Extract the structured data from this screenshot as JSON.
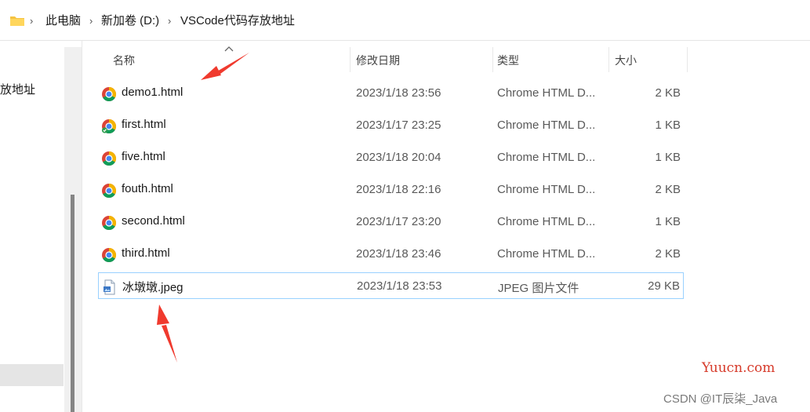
{
  "breadcrumb": {
    "items": [
      "此电脑",
      "新加卷 (D:)",
      "VSCode代码存放地址"
    ],
    "separator": "›"
  },
  "nav": {
    "partial_item": "放地址"
  },
  "columns": {
    "name": "名称",
    "date": "修改日期",
    "type": "类型",
    "size": "大小"
  },
  "files": [
    {
      "name": "demo1.html",
      "date": "2023/1/18 23:56",
      "type": "Chrome HTML D...",
      "size": "2 KB",
      "icon": "chrome-icon"
    },
    {
      "name": "first.html",
      "date": "2023/1/17 23:25",
      "type": "Chrome HTML D...",
      "size": "1 KB",
      "icon": "chrome-icon"
    },
    {
      "name": "five.html",
      "date": "2023/1/18 20:04",
      "type": "Chrome HTML D...",
      "size": "1 KB",
      "icon": "chrome-icon"
    },
    {
      "name": "fouth.html",
      "date": "2023/1/18 22:16",
      "type": "Chrome HTML D...",
      "size": "2 KB",
      "icon": "chrome-icon"
    },
    {
      "name": "second.html",
      "date": "2023/1/17 23:20",
      "type": "Chrome HTML D...",
      "size": "1 KB",
      "icon": "chrome-icon"
    },
    {
      "name": "third.html",
      "date": "2023/1/18 23:46",
      "type": "Chrome HTML D...",
      "size": "2 KB",
      "icon": "chrome-icon"
    },
    {
      "name": "冰墩墩.jpeg",
      "date": "2023/1/18 23:53",
      "type": "JPEG 图片文件",
      "size": "29 KB",
      "icon": "image-file-icon"
    }
  ],
  "watermarks": {
    "site": "Yuucn.com",
    "author": "CSDN @IT辰柒_Java"
  },
  "colors": {
    "selection_border": "#99d1ff",
    "annotation_arrow": "#f03a2e",
    "watermark_site": "#d63a2a"
  }
}
